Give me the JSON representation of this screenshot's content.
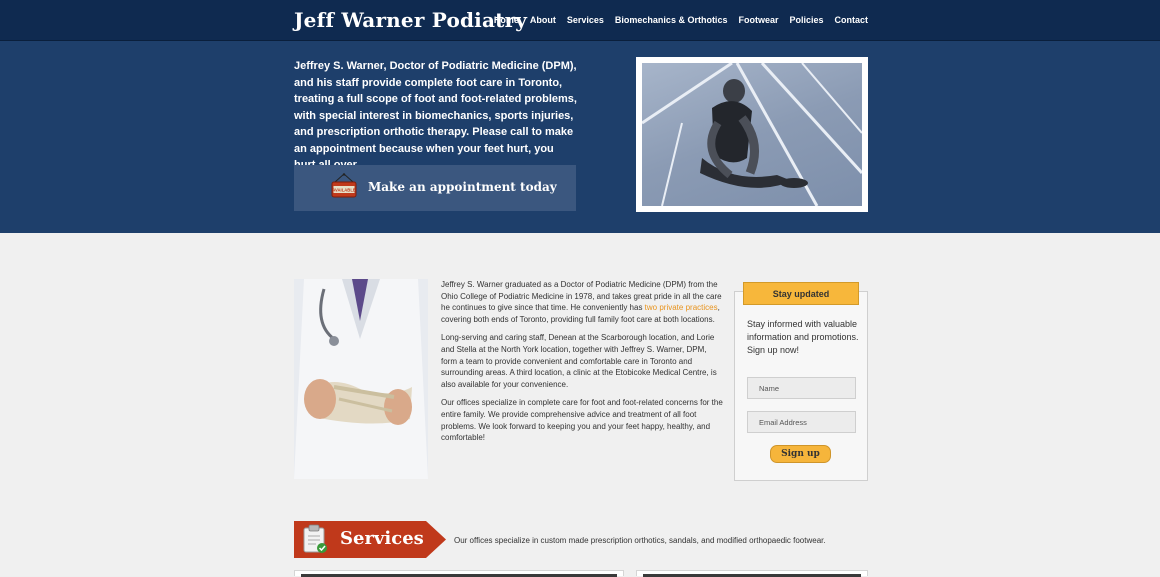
{
  "header": {
    "brand": "Jeff Warner Podiatry",
    "nav": [
      "Home",
      "About",
      "Services",
      "Biomechanics & Orthotics",
      "Footwear",
      "Policies",
      "Contact"
    ]
  },
  "hero": {
    "intro": "Jeffrey S. Warner, Doctor of Podiatric Medicine (DPM), and his staff provide complete foot care in Toronto, treating a full scope of foot and foot-related problems, with special interest in biomechanics, sports injuries, and prescription orthotic therapy. Please call to make an appointment because when your feet hurt, you hurt all over.",
    "appointment_label": "Make an appointment today",
    "sign_text": "AVAILABLE"
  },
  "main": {
    "p1_a": "Jeffrey S. Warner graduated as a Doctor of Podiatric Medicine (DPM) from the Ohio College of Podiatric Medicine in 1978, and takes great pride in all the care he continues to give since that time. He conveniently has ",
    "p1_link": "two private practices",
    "p1_b": ", covering both ends of Toronto, providing full family foot care at both locations.",
    "p2": "Long-serving and caring staff, Denean at the Scarborough location, and Lorie and Stella at the North York location, together with Jeffrey S. Warner, DPM, form a team to provide convenient and comfortable care in Toronto and surrounding areas. A third location, a clinic at the Etobicoke Medical Centre, is also available for your convenience.",
    "p3": "Our offices specialize in complete care for foot and foot-related concerns for the entire family. We provide comprehensive advice and treatment of all foot problems. We look forward to keeping you and your feet happy, healthy, and comfortable!"
  },
  "signup": {
    "tab": "Stay updated",
    "text": "Stay informed with valuable information and promotions. Sign up now!",
    "name_placeholder": "Name",
    "email_placeholder": "Email Address",
    "button": "Sign up"
  },
  "services": {
    "title": "Services",
    "text": "Our offices specialize in custom made prescription orthotics, sandals, and modified orthopaedic footwear."
  },
  "colors": {
    "topbar": "#0f2a50",
    "hero": "#1e3f6b",
    "accent_orange": "#e8931d",
    "banner_red": "#c0391b",
    "tab_yellow": "#f7b73b"
  },
  "icons": [
    "available-sign-icon",
    "clipboard-icon"
  ]
}
